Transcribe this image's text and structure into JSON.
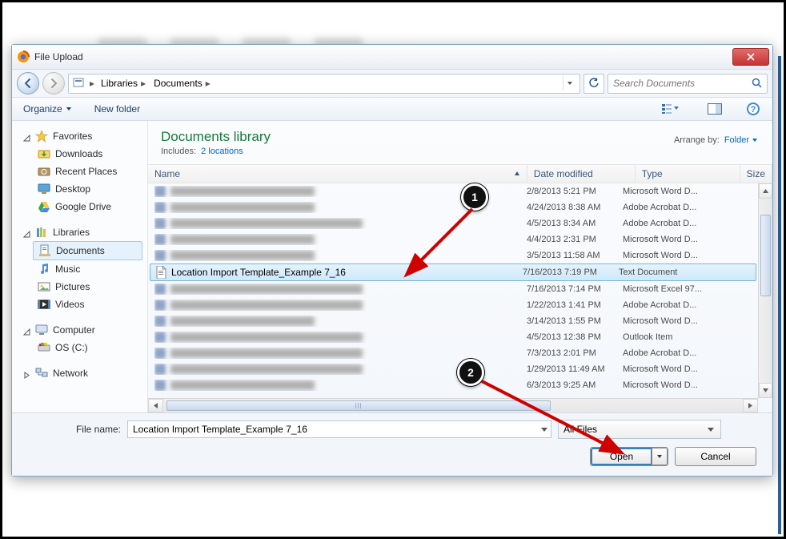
{
  "window_title": "File Upload",
  "breadcrumb": {
    "items": [
      "Libraries",
      "Documents"
    ]
  },
  "search": {
    "placeholder": "Search Documents"
  },
  "toolbar": {
    "organize": "Organize",
    "newfolder": "New folder"
  },
  "library": {
    "title": "Documents library",
    "includes_prefix": "Includes:",
    "includes_link": "2 locations",
    "arrange_label": "Arrange by:",
    "arrange_value": "Folder"
  },
  "sidebar": {
    "favorites": {
      "label": "Favorites",
      "items": [
        "Downloads",
        "Recent Places",
        "Desktop",
        "Google Drive"
      ]
    },
    "libraries": {
      "label": "Libraries",
      "items": [
        "Documents",
        "Music",
        "Pictures",
        "Videos"
      ],
      "selected": "Documents"
    },
    "computer": {
      "label": "Computer",
      "items": [
        "OS (C:)"
      ]
    },
    "network": {
      "label": "Network"
    }
  },
  "columns": {
    "name": "Name",
    "date": "Date modified",
    "type": "Type",
    "size": "Size"
  },
  "files": [
    {
      "date": "2/8/2013 5:21 PM",
      "type": "Microsoft Word D..."
    },
    {
      "date": "4/24/2013 8:38 AM",
      "type": "Adobe Acrobat D..."
    },
    {
      "date": "4/5/2013 8:34 AM",
      "type": "Adobe Acrobat D..."
    },
    {
      "date": "4/4/2013 2:31 PM",
      "type": "Microsoft Word D..."
    },
    {
      "date": "3/5/2013 11:58 AM",
      "type": "Microsoft Word D..."
    },
    {
      "name": "Location Import Template_Example 7_16",
      "date": "7/16/2013 7:19 PM",
      "type": "Text Document",
      "selected": true
    },
    {
      "date": "7/16/2013 7:14 PM",
      "type": "Microsoft Excel 97..."
    },
    {
      "date": "1/22/2013 1:41 PM",
      "type": "Adobe Acrobat D..."
    },
    {
      "date": "3/14/2013 1:55 PM",
      "type": "Microsoft Word D..."
    },
    {
      "date": "4/5/2013 12:38 PM",
      "type": "Outlook Item"
    },
    {
      "date": "7/3/2013 2:01 PM",
      "type": "Adobe Acrobat D..."
    },
    {
      "date": "1/29/2013 11:49 AM",
      "type": "Microsoft Word D..."
    },
    {
      "date": "6/3/2013 9:25 AM",
      "type": "Microsoft Word D..."
    }
  ],
  "bottom": {
    "filename_label": "File name:",
    "filename_value": "Location Import Template_Example 7_16",
    "filter": "All Files",
    "open": "Open",
    "cancel": "Cancel"
  },
  "annotations": [
    {
      "n": "1"
    },
    {
      "n": "2"
    }
  ]
}
